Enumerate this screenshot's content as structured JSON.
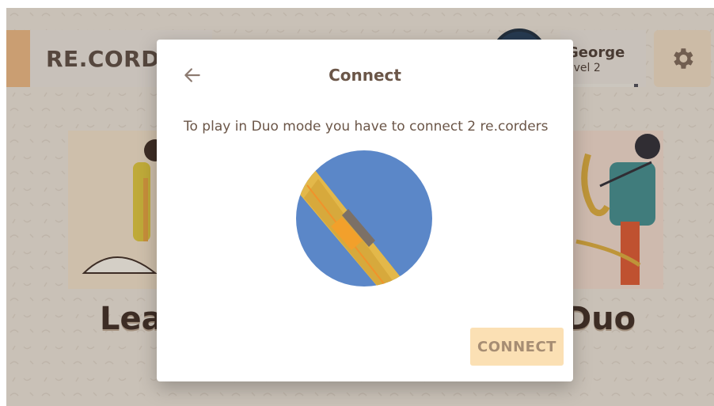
{
  "header": {
    "logo_text": "RE.CORD",
    "profile": {
      "name": "George",
      "level": "evel 2",
      "progress": 0.95
    },
    "settings_icon": "gear-icon"
  },
  "modes": {
    "left_label": "Lea",
    "right_label": "Duo"
  },
  "dialog": {
    "back_icon": "arrow-left-icon",
    "title": "Connect",
    "message": "To play in Duo mode you have to connect 2 re.corders",
    "button_label": "CONNECT",
    "illustration": "recorder-in-circle"
  },
  "colors": {
    "circle": "#5b87c8",
    "recorder": "#e3b84a",
    "button_bg": "#fbe0b4",
    "title": "#6b5648"
  }
}
